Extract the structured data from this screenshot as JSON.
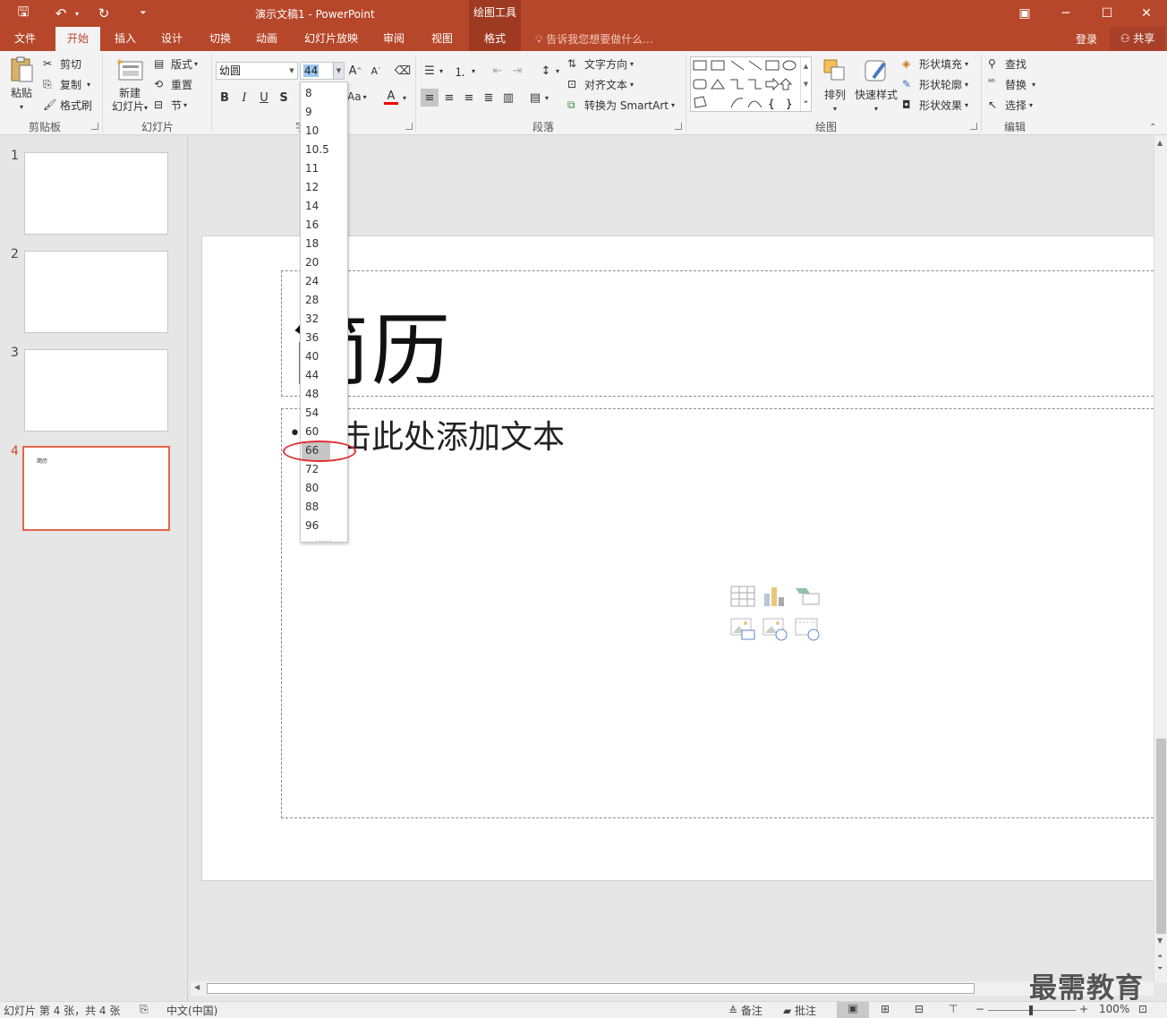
{
  "window": {
    "title": "演示文稿1 - PowerPoint",
    "contextual_header": "绘图工具",
    "minimize": "─",
    "maximize": "☐",
    "close": "✕",
    "restore_ribbon": "▣"
  },
  "quick_access": {
    "save": "🖫",
    "undo": "↶",
    "redo": "↻",
    "customize": "⏷"
  },
  "tabs": [
    {
      "label": "文件"
    },
    {
      "label": "开始"
    },
    {
      "label": "插入"
    },
    {
      "label": "设计"
    },
    {
      "label": "切换"
    },
    {
      "label": "动画"
    },
    {
      "label": "幻灯片放映"
    },
    {
      "label": "审阅"
    },
    {
      "label": "视图"
    },
    {
      "label": "格式"
    }
  ],
  "tell_me": "告诉我您想要做什么...",
  "sign_in": "登录",
  "share": "共享",
  "ribbon": {
    "clipboard": {
      "label": "剪贴板",
      "paste": "粘贴",
      "cut": "剪切",
      "copy": "复制",
      "format_painter": "格式刷"
    },
    "slides": {
      "label": "幻灯片",
      "new_slide_1": "新建",
      "new_slide_2": "幻灯片",
      "layout": "版式",
      "reset": "重置",
      "section": "节"
    },
    "font": {
      "label": "字",
      "font_name": "幼圆",
      "font_size": "44",
      "change_case": "Aa"
    },
    "paragraph": {
      "label": "段落",
      "text_direction": "文字方向",
      "align_text": "对齐文本",
      "convert_smartart": "转换为 SmartArt"
    },
    "drawing": {
      "label": "绘图",
      "arrange": "排列",
      "quick_styles": "快速样式",
      "shape_fill": "形状填充",
      "shape_outline": "形状轮廓",
      "shape_effects": "形状效果"
    },
    "editing": {
      "label": "编辑",
      "find": "查找",
      "replace": "替换",
      "select": "选择"
    }
  },
  "font_size_dropdown": {
    "sizes": [
      "8",
      "9",
      "10",
      "10.5",
      "11",
      "12",
      "14",
      "16",
      "18",
      "20",
      "24",
      "28",
      "32",
      "36",
      "40",
      "44",
      "48",
      "54",
      "60",
      "66",
      "72",
      "80",
      "88",
      "96"
    ],
    "highlighted": "66",
    "grip": "....."
  },
  "thumbnails": [
    {
      "number": "1"
    },
    {
      "number": "2"
    },
    {
      "number": "3"
    },
    {
      "number": "4",
      "mini_text": "简历"
    }
  ],
  "slide": {
    "title": "简历",
    "body_placeholder": "单击此处添加文本",
    "bullet": "•"
  },
  "status": {
    "slide_info": "幻灯片 第 4 张，共 4 张",
    "language": "中文(中国)",
    "notes": "备注",
    "comments": "批注",
    "zoom": "100%",
    "zoom_out": "−",
    "zoom_in": "+"
  },
  "watermark": "最需教育",
  "colors": {
    "accent": "#b7472a",
    "contextual": "#9e3a21",
    "highlight_circle": "#e03030",
    "selected_thumb": "#e0684b"
  }
}
